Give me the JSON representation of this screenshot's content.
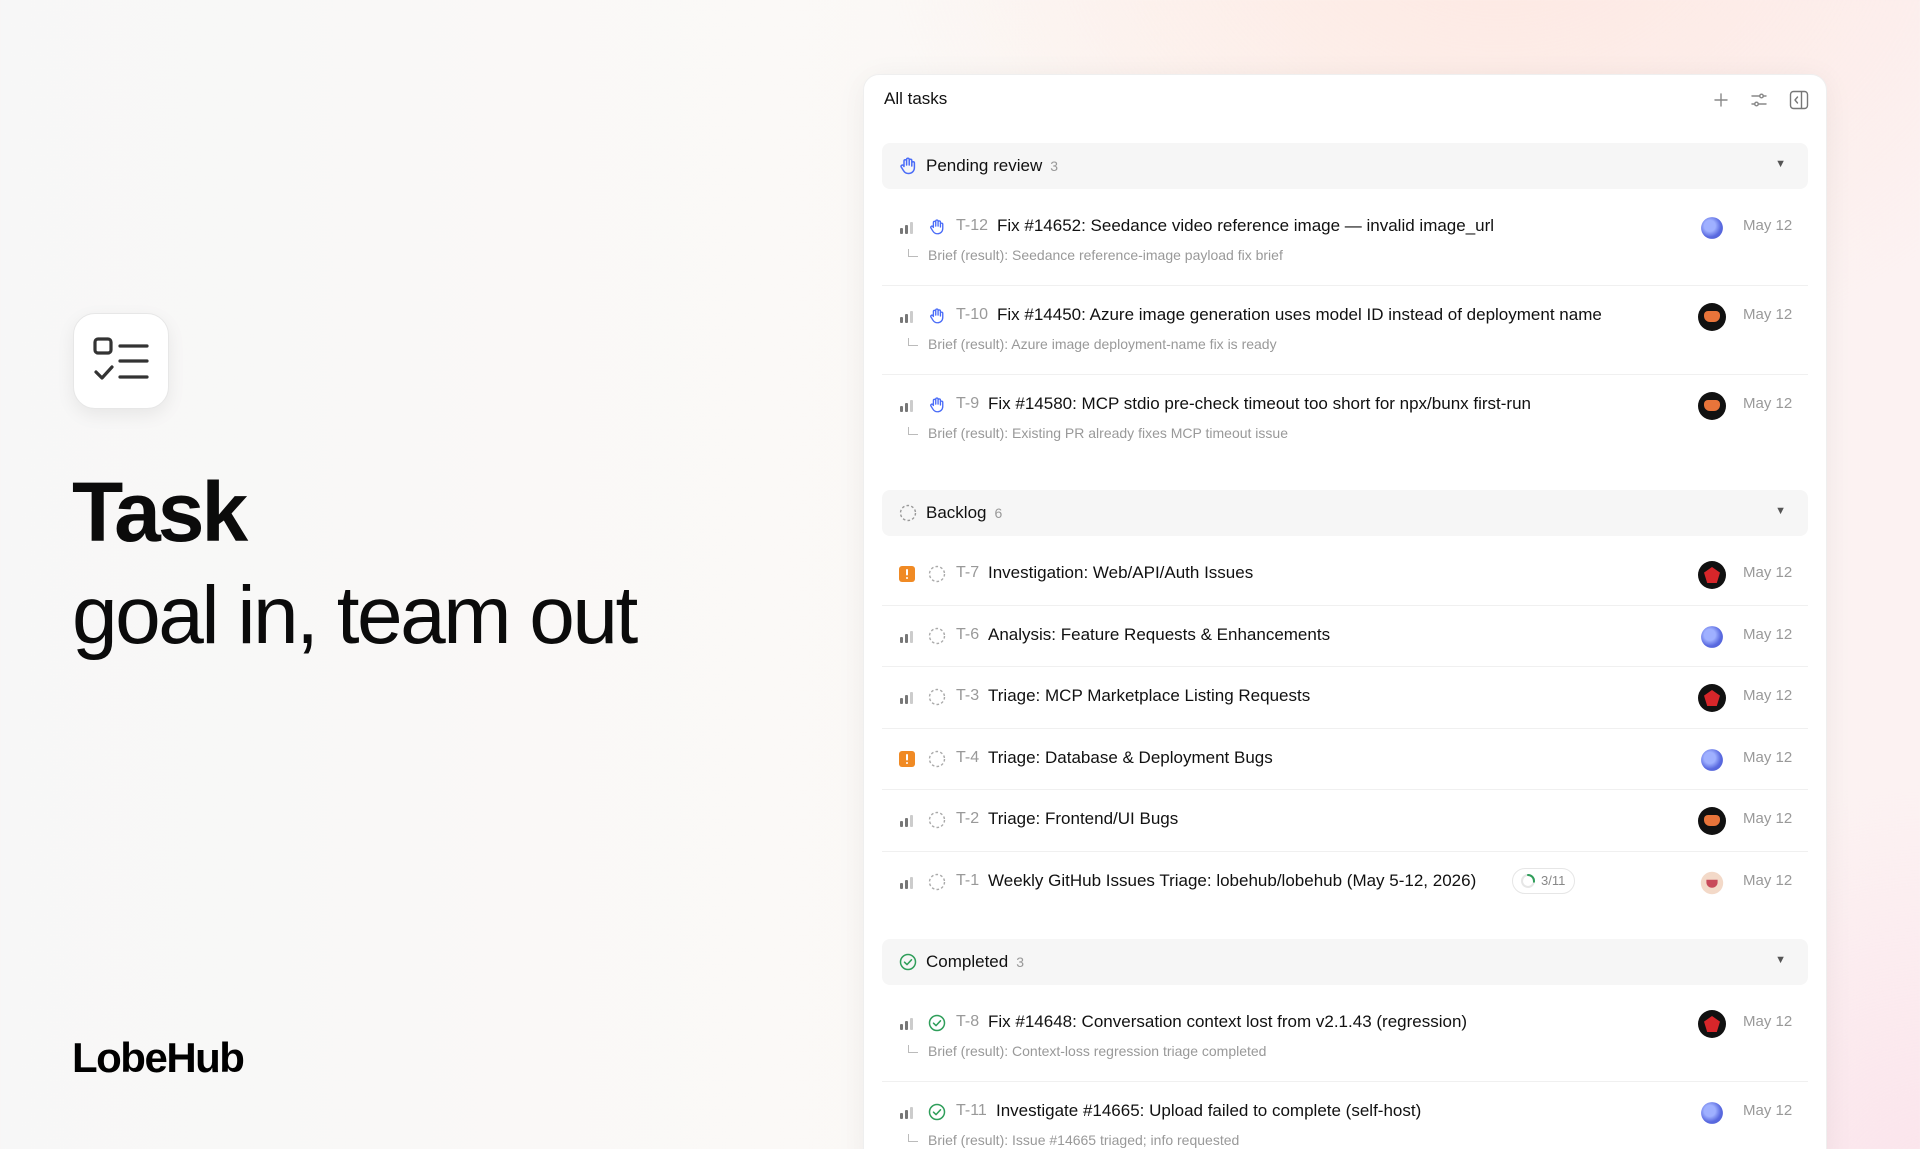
{
  "hero": {
    "title": "Task",
    "subtitle": "goal in, team out",
    "brand": "LobeHub"
  },
  "panel": {
    "title": "All tasks"
  },
  "colors": {
    "pending_icon": "#4a6cf7",
    "completed_icon": "#2f9e5a",
    "urgent_badge": "#f08a24"
  },
  "groups": [
    {
      "name": "Pending review",
      "count": "3",
      "icon": "hand-icon",
      "tasks": [
        {
          "id": "T-12",
          "title": "Fix #14652: Seedance video reference image — invalid image_url",
          "brief": "Brief (result): Seedance reference-image payload fix brief",
          "date": "May 12",
          "priority": "priority-bars-icon",
          "avatar": "blue"
        },
        {
          "id": "T-10",
          "title": "Fix #14450: Azure image generation uses model ID instead of deployment name",
          "brief": "Brief (result): Azure image deployment-name fix is ready",
          "date": "May 12",
          "priority": "priority-bars-icon",
          "avatar": "dark"
        },
        {
          "id": "T-9",
          "title": "Fix #14580: MCP stdio pre-check timeout too short for npx/bunx first-run",
          "brief": "Brief (result): Existing PR already fixes MCP timeout issue",
          "date": "May 12",
          "priority": "priority-bars-icon",
          "avatar": "dark"
        }
      ]
    },
    {
      "name": "Backlog",
      "count": "6",
      "icon": "dashed-circle-icon",
      "tasks": [
        {
          "id": "T-7",
          "title": "Investigation: Web/API/Auth Issues",
          "date": "May 12",
          "priority": "urgent-icon",
          "avatar": "red"
        },
        {
          "id": "T-6",
          "title": "Analysis: Feature Requests & Enhancements",
          "date": "May 12",
          "priority": "priority-bars-icon",
          "avatar": "blue"
        },
        {
          "id": "T-3",
          "title": "Triage: MCP Marketplace Listing Requests",
          "date": "May 12",
          "priority": "priority-bars-icon",
          "avatar": "red"
        },
        {
          "id": "T-4",
          "title": "Triage: Database & Deployment Bugs",
          "date": "May 12",
          "priority": "urgent-icon",
          "avatar": "blue"
        },
        {
          "id": "T-2",
          "title": "Triage: Frontend/UI Bugs",
          "date": "May 12",
          "priority": "priority-bars-icon",
          "avatar": "dark"
        },
        {
          "id": "T-1",
          "title": "Weekly GitHub Issues Triage: lobehub/lobehub (May 5-12, 2026)",
          "progress": "3/11",
          "progress_fraction": 0.27,
          "date": "May 12",
          "priority": "priority-bars-icon",
          "avatar": "face"
        }
      ]
    },
    {
      "name": "Completed",
      "count": "3",
      "icon": "check-circle-icon",
      "tasks": [
        {
          "id": "T-8",
          "title": "Fix #14648: Conversation context lost from v2.1.43 (regression)",
          "brief": "Brief (result): Context-loss regression triage completed",
          "date": "May 12",
          "priority": "priority-bars-icon",
          "avatar": "red"
        },
        {
          "id": "T-11",
          "title": "Investigate #14665: Upload failed to complete (self-host)",
          "brief": "Brief (result): Issue #14665 triaged; info requested",
          "date": "May 12",
          "priority": "priority-bars-icon",
          "avatar": "blue"
        }
      ]
    }
  ]
}
